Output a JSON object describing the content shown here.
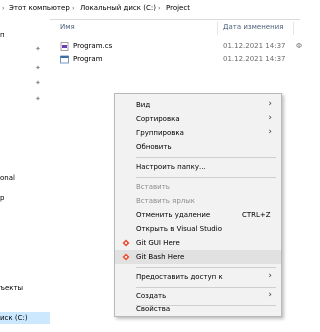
{
  "breadcrumb": {
    "items": [
      "Этот компьютер",
      "Локальный диск (C:)",
      "Project"
    ]
  },
  "nav": {
    "items": [
      {
        "label": "п"
      },
      {
        "label": "onal"
      },
      {
        "label": "р"
      },
      {
        "label": "ъекты"
      },
      {
        "label": "иск (C:)"
      }
    ]
  },
  "columns": {
    "name": "Имя",
    "date": "Дата изменения"
  },
  "files": [
    {
      "name": "Program.cs",
      "date": "01.12.2021 14:37",
      "extra": "Ф",
      "icon": "cs-file-icon"
    },
    {
      "name": "Program",
      "date": "01.12.2021 14:37",
      "extra": "",
      "icon": "exe-file-icon"
    }
  ],
  "context_menu": {
    "view": "Вид",
    "sort": "Сортировка",
    "group": "Группировка",
    "refresh": "Обновить",
    "customize": "Настроить папку...",
    "paste": "Вставить",
    "paste_shortcut": "Вставить ярлык",
    "undo_delete": "Отменить удаление",
    "undo_shortcut": "CTRL+Z",
    "open_vs": "Открыть в Visual Studio",
    "git_gui": "Git GUI Here",
    "git_bash": "Git Bash Here",
    "share": "Предоставить доступ к",
    "create": "Создать",
    "properties": "Свойства"
  },
  "colors": {
    "accent": "#cce8ff",
    "menu_bg": "#f2f2f2",
    "hover": "#e1e1e1",
    "disabled_text": "#8d8d8d"
  }
}
